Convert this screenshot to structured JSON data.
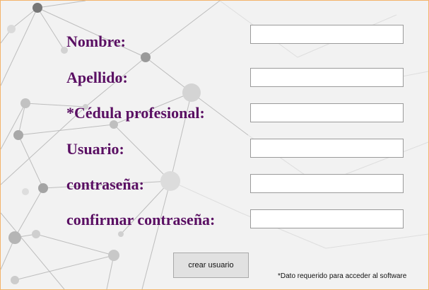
{
  "form": {
    "fields": [
      {
        "label": "Nombre:",
        "value": ""
      },
      {
        "label": "Apellido:",
        "value": ""
      },
      {
        "label": "*Cédula profesional:",
        "value": ""
      },
      {
        "label": "Usuario:",
        "value": ""
      },
      {
        "label": "contraseña:",
        "value": ""
      },
      {
        "label": "confirmar contraseña:",
        "value": ""
      }
    ],
    "submit_label": "crear usuario",
    "footnote": "*Dato requerido para acceder al software"
  },
  "colors": {
    "label": "#5a0f63",
    "window_border": "#f3b36a",
    "background": "#f2f2f2"
  }
}
